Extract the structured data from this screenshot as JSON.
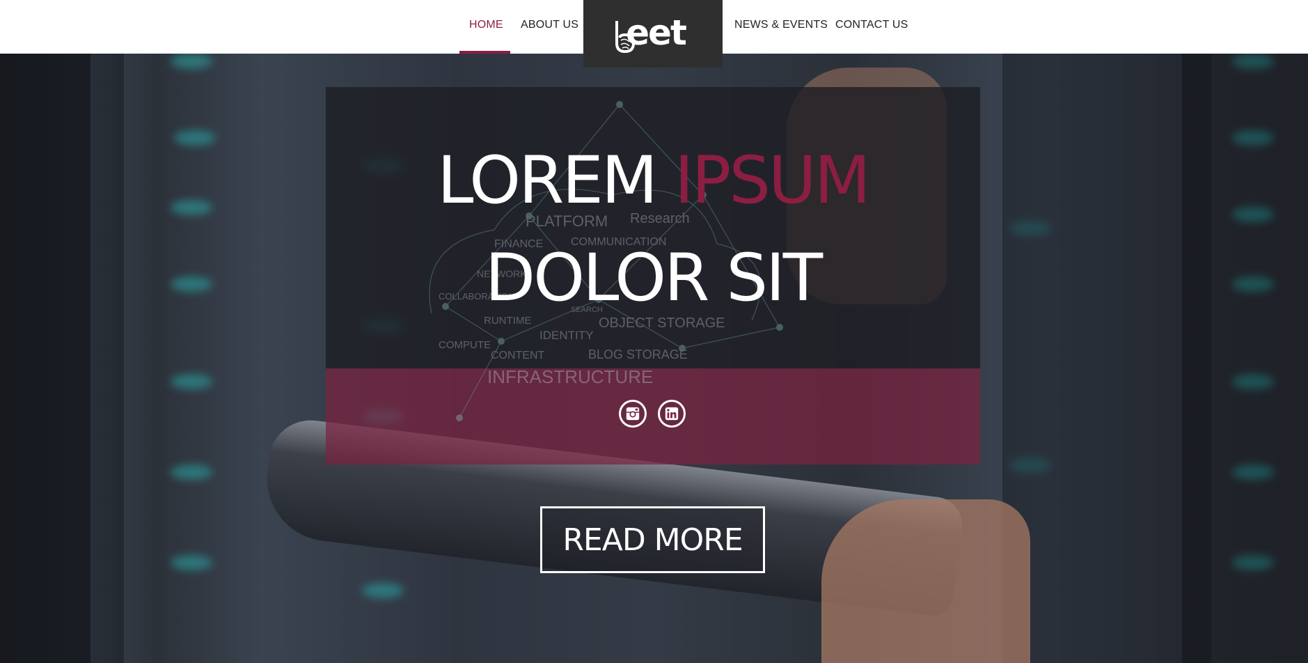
{
  "nav": {
    "items": [
      {
        "label": "HOME",
        "active": true
      },
      {
        "label": "ABOUT US",
        "active": false
      },
      {
        "label": "NEWS & EVENTS",
        "active": false
      },
      {
        "label": "CONTACT US",
        "active": false
      }
    ],
    "logo_text": "eet"
  },
  "hero": {
    "line1_plain": "LOREM",
    "line1_accent": "IPSUM",
    "line2": "DOLOR SIT",
    "read_more": "READ MORE",
    "diagram_words": [
      "PLATFORM",
      "Research",
      "FINANCE",
      "COMMUNICATION",
      "NETWORK",
      "COLLABORATION",
      "RUNTIME",
      "SEARCH",
      "OBJECT STORAGE",
      "IDENTITY",
      "COMPUTE",
      "CONTENT",
      "BLOG STORAGE",
      "INFRASTRUCTURE"
    ]
  },
  "social": [
    {
      "icon": "instagram-icon"
    },
    {
      "icon": "linkedin-icon"
    }
  ],
  "colors": {
    "accent": "#8b1e41",
    "panel_dark": "#1e1e24",
    "panel_accent": "#7a2240",
    "nav_bg": "#ffffff",
    "logo_bg": "#2f2f2f"
  }
}
